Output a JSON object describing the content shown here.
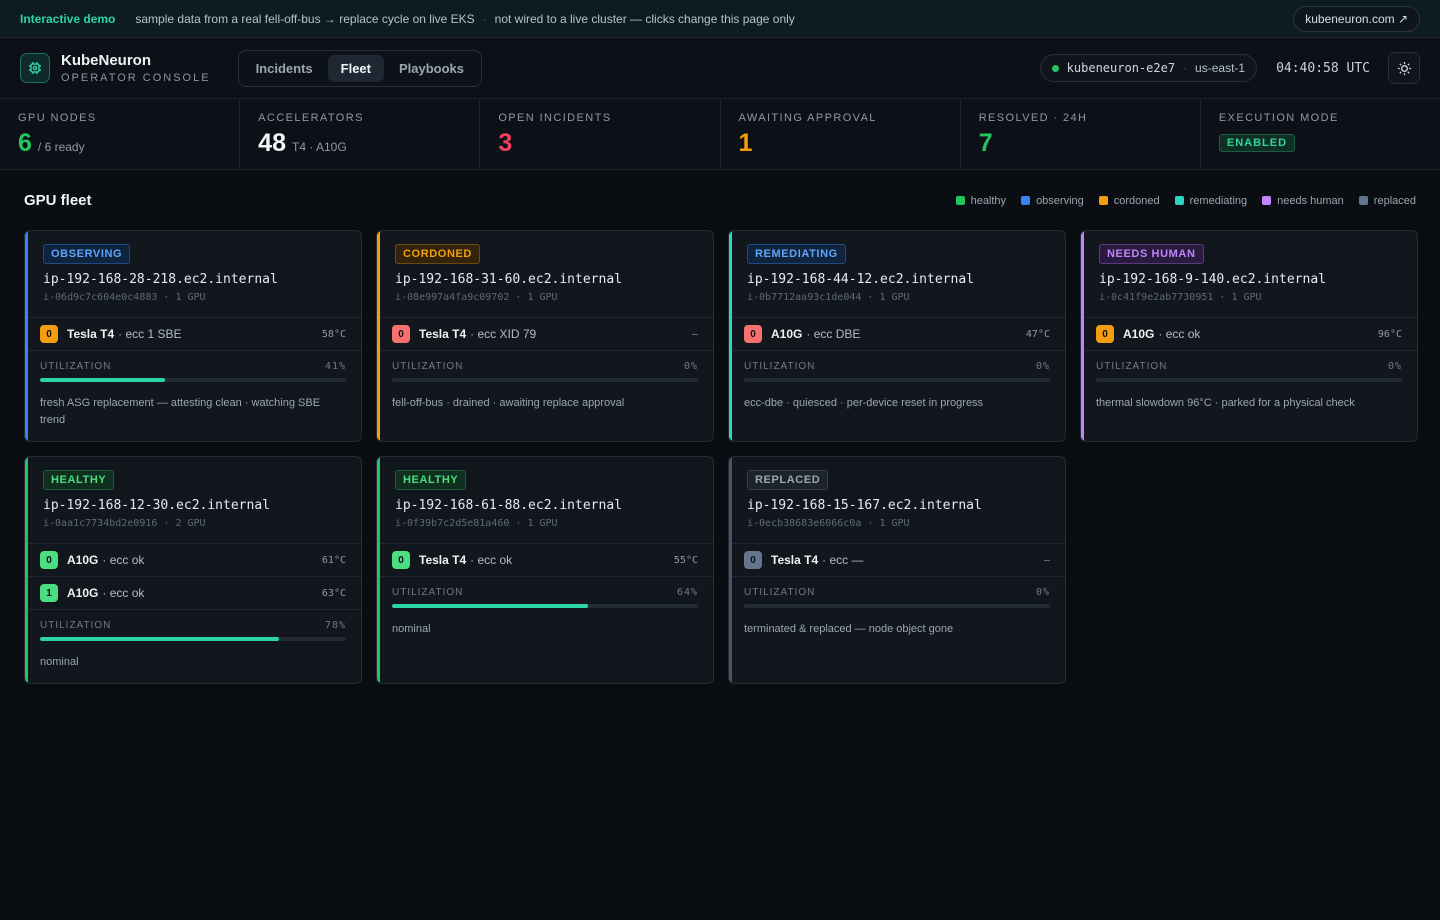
{
  "banner": {
    "tag": "Interactive demo",
    "msg1": "sample data from a real fell-off-bus → replace cycle on live EKS",
    "msg2": "not wired to a live cluster — clicks change this page only",
    "site": "kubeneuron.com ↗"
  },
  "header": {
    "brand": "KubeNeuron",
    "subtitle": "OPERATOR CONSOLE",
    "tabs": [
      "Incidents",
      "Fleet",
      "Playbooks"
    ],
    "active_tab": "Fleet",
    "cluster": "kubeneuron-e2e7",
    "region": "us-east-1",
    "clock": "04:40:58 UTC"
  },
  "stats": [
    {
      "label": "GPU NODES",
      "value": "6",
      "sub": "/ 6 ready",
      "color": "#22c55e"
    },
    {
      "label": "ACCELERATORS",
      "value": "48",
      "sub": "T4 · A10G",
      "color": "#f1f5f9"
    },
    {
      "label": "OPEN INCIDENTS",
      "value": "3",
      "sub": "",
      "color": "#f43f5e"
    },
    {
      "label": "AWAITING APPROVAL",
      "value": "1",
      "sub": "",
      "color": "#f59e0b"
    },
    {
      "label": "RESOLVED · 24H",
      "value": "7",
      "sub": "",
      "color": "#22c55e"
    },
    {
      "label": "EXECUTION MODE",
      "value": "",
      "sub": "",
      "badge": "ENABLED",
      "color": "#34d399"
    }
  ],
  "fleet": {
    "title": "GPU fleet",
    "legend": [
      {
        "label": "healthy",
        "color": "#22c55e"
      },
      {
        "label": "observing",
        "color": "#3b82f6"
      },
      {
        "label": "cordoned",
        "color": "#f59e0b"
      },
      {
        "label": "remediating",
        "color": "#2dd4bf"
      },
      {
        "label": "needs human",
        "color": "#c084fc"
      },
      {
        "label": "replaced",
        "color": "#64748b"
      }
    ],
    "util_label": "UTILIZATION",
    "cards": [
      {
        "status": "OBSERVING",
        "status_color": "#60a5fa",
        "status_bg": "#10243f",
        "status_border": "#1e4a80",
        "accent": "#3b82f6",
        "host": "ip-192-168-28-218.ec2.internal",
        "instance": "i-06d9c7c604e0c4883 · 1 GPU",
        "gpus": [
          {
            "idx": "0",
            "idx_color": "#f59e0b",
            "model": "Tesla T4",
            "ecc": "· ecc 1 SBE",
            "temp": "58°C"
          }
        ],
        "util": "41%",
        "util_value": 41,
        "note": "fresh ASG replacement — attesting clean · watching SBE trend"
      },
      {
        "status": "CORDONED",
        "status_color": "#f59e0b",
        "status_bg": "#33230b",
        "status_border": "#6b4a12",
        "accent": "#f59e0b",
        "host": "ip-192-168-31-60.ec2.internal",
        "instance": "i-08e997a4fa9c09702 · 1 GPU",
        "gpus": [
          {
            "idx": "0",
            "idx_color": "#f87171",
            "model": "Tesla T4",
            "ecc": "· ecc XID 79",
            "temp": "–"
          }
        ],
        "util": "0%",
        "util_value": 0,
        "note": "fell-off-bus · drained · awaiting replace approval"
      },
      {
        "status": "REMEDIATING",
        "status_color": "#60a5fa",
        "status_bg": "#10243f",
        "status_border": "#1e4a80",
        "accent": "#2dd4bf",
        "host": "ip-192-168-44-12.ec2.internal",
        "instance": "i-0b7712aa93c1de044 · 1 GPU",
        "gpus": [
          {
            "idx": "0",
            "idx_color": "#f87171",
            "model": "A10G",
            "ecc": "· ecc DBE",
            "temp": "47°C"
          }
        ],
        "util": "0%",
        "util_value": 0,
        "note": "ecc-dbe · quiesced · per-device reset in progress"
      },
      {
        "status": "NEEDS HUMAN",
        "status_color": "#c084fc",
        "status_bg": "#2a1a3f",
        "status_border": "#5a3a80",
        "accent": "#c084fc",
        "host": "ip-192-168-9-140.ec2.internal",
        "instance": "i-0c41f9e2ab7730951 · 1 GPU",
        "gpus": [
          {
            "idx": "0",
            "idx_color": "#f59e0b",
            "model": "A10G",
            "ecc": "· ecc ok",
            "temp": "96°C"
          }
        ],
        "util": "0%",
        "util_value": 0,
        "note": "thermal slowdown 96°C · parked for a physical check"
      },
      {
        "status": "HEALTHY",
        "status_color": "#4ade80",
        "status_bg": "#0f2f1f",
        "status_border": "#1f5a3a",
        "accent": "#22c55e",
        "host": "ip-192-168-12-30.ec2.internal",
        "instance": "i-0aa1c7734bd2e0916 · 2 GPU",
        "gpus": [
          {
            "idx": "0",
            "idx_color": "#4ade80",
            "model": "A10G",
            "ecc": "· ecc ok",
            "temp": "61°C"
          },
          {
            "idx": "1",
            "idx_color": "#4ade80",
            "model": "A10G",
            "ecc": "· ecc ok",
            "temp": "63°C"
          }
        ],
        "util": "78%",
        "util_value": 78,
        "note": "nominal"
      },
      {
        "status": "HEALTHY",
        "status_color": "#4ade80",
        "status_bg": "#0f2f1f",
        "status_border": "#1f5a3a",
        "accent": "#22c55e",
        "host": "ip-192-168-61-88.ec2.internal",
        "instance": "i-0f39b7c2d5e81a460 · 1 GPU",
        "gpus": [
          {
            "idx": "0",
            "idx_color": "#4ade80",
            "model": "Tesla T4",
            "ecc": "· ecc ok",
            "temp": "55°C"
          }
        ],
        "util": "64%",
        "util_value": 64,
        "note": "nominal"
      },
      {
        "status": "REPLACED",
        "status_color": "#9aa6b2",
        "status_bg": "#1c232c",
        "status_border": "#36414d",
        "accent": "#475569",
        "host": "ip-192-168-15-167.ec2.internal",
        "instance": "i-0ecb38683e6066c0a · 1 GPU",
        "gpus": [
          {
            "idx": "0",
            "idx_color": "#64748b",
            "model": "Tesla T4",
            "ecc": "· ecc —",
            "temp": "–"
          }
        ],
        "util": "0%",
        "util_value": 0,
        "note": "terminated & replaced — node object gone"
      }
    ]
  }
}
